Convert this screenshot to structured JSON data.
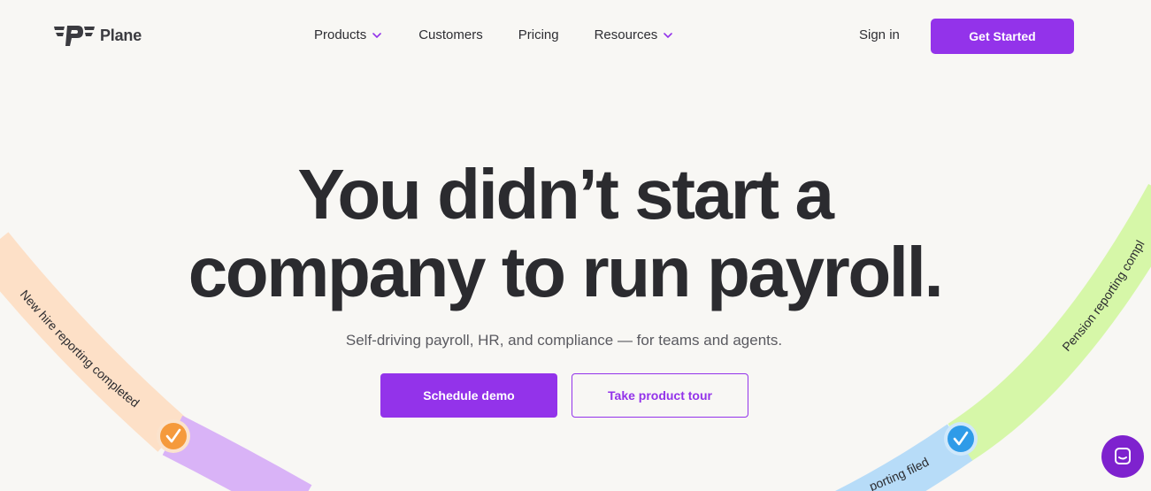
{
  "brand": {
    "name": "Plane",
    "logo_icon": "plane-wings-logo-icon",
    "accent": "#9333ea"
  },
  "nav": {
    "items": [
      {
        "label": "Products",
        "has_dropdown": true
      },
      {
        "label": "Customers",
        "has_dropdown": false
      },
      {
        "label": "Pricing",
        "has_dropdown": false
      },
      {
        "label": "Resources",
        "has_dropdown": true
      }
    ],
    "sign_in": "Sign in",
    "cta": "Get Started"
  },
  "hero": {
    "headline_line1": "You didn’t start a",
    "headline_line2": "company to run payroll.",
    "subheadline": "Self-driving payroll, HR, and compliance — for teams and agents.",
    "primary_cta": "Schedule demo",
    "secondary_cta": "Take product tour"
  },
  "status_ribbons": {
    "left": {
      "label": "New hire reporting completed",
      "check_color": "#f59a3c"
    },
    "right_lower": {
      "label": "porting filed",
      "check_color": "#2f9be8"
    },
    "right_upper": {
      "label": "Pension reporting compl"
    }
  },
  "chat": {
    "icon": "chat-bubble-icon"
  }
}
